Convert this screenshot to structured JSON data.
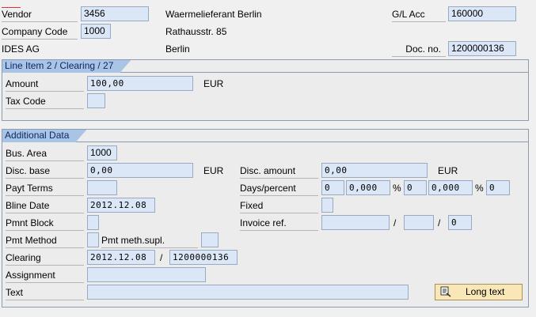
{
  "header": {
    "vendor_label": "Vendor",
    "vendor_value": "3456",
    "company_code_label": "Company Code",
    "company_code_value": "1000",
    "company_name": "IDES AG",
    "vendor_name": "Waermelieferant Berlin",
    "street": "Rathausstr. 85",
    "city": "Berlin",
    "gl_acc_label": "G/L Acc",
    "gl_acc_value": "160000",
    "doc_no_label": "Doc. no.",
    "doc_no_value": "1200000136"
  },
  "line_item": {
    "title": "Line Item 2 / Clearing / 27",
    "amount_label": "Amount",
    "amount_value": "100,00",
    "amount_currency": "EUR",
    "tax_code_label": "Tax Code",
    "tax_code_value": ""
  },
  "additional": {
    "title": "Additional Data",
    "bus_area_label": "Bus. Area",
    "bus_area_value": "1000",
    "disc_base_label": "Disc. base",
    "disc_base_value": "0,00",
    "disc_base_currency": "EUR",
    "disc_amount_label": "Disc. amount",
    "disc_amount_value": "0,00",
    "disc_amount_currency": "EUR",
    "payt_terms_label": "Payt Terms",
    "payt_terms_value": "",
    "days_percent_label": "Days/percent",
    "days1": "0",
    "pct1": "0,000",
    "pct_sign": "%",
    "days2": "0",
    "pct2": "0,000",
    "days3": "0",
    "bline_date_label": "Bline Date",
    "bline_date_value": "2012.12.08",
    "fixed_label": "Fixed",
    "fixed_value": "",
    "pmnt_block_label": "Pmnt Block",
    "pmnt_block_value": "",
    "invoice_ref_label": "Invoice ref.",
    "invoice_ref_1": "",
    "invoice_ref_2": "",
    "invoice_ref_3": "0",
    "slash": "/",
    "pmt_method_label": "Pmt Method",
    "pmt_method_value": "",
    "pmt_meth_supl_label": "Pmt meth.supl.",
    "pmt_meth_supl_value": "",
    "clearing_label": "Clearing",
    "clearing_date": "2012.12.08",
    "clearing_doc": "1200000136",
    "assignment_label": "Assignment",
    "assignment_value": "",
    "text_label": "Text",
    "text_value": "",
    "long_text_button": "Long text"
  },
  "colors": {
    "field_bg": "#dbe6f7",
    "tab_bg": "#a9c4e4",
    "button_bg": "#f9e7b8"
  }
}
